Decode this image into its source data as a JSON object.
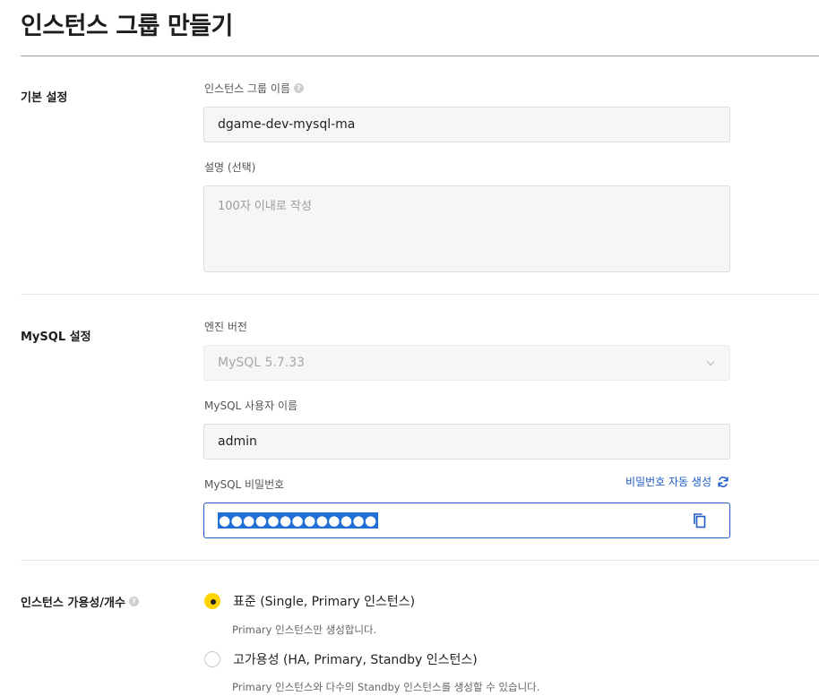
{
  "page": {
    "title": "인스턴스 그룹 만들기"
  },
  "basic": {
    "section_label": "기본 설정",
    "group_name_label": "인스턴스 그룹 이름",
    "group_name_value": "dgame-dev-mysql-ma",
    "description_label": "설명 (선택)",
    "description_placeholder": "100자 이내로 작성"
  },
  "mysql": {
    "section_label": "MySQL 설정",
    "engine_label": "엔진 버전",
    "engine_value": "MySQL 5.7.33",
    "username_label": "MySQL 사용자 이름",
    "username_value": "admin",
    "password_label": "MySQL 비밀번호",
    "password_autogen": "비밀번호 자동 생성",
    "password_mask": "●●●●●●●●●●●●●"
  },
  "availability": {
    "section_label": "인스턴스 가용성/개수",
    "options": [
      {
        "label": "표준 (Single, Primary 인스턴스)",
        "description": "Primary 인스턴스만 생성합니다.",
        "selected": true
      },
      {
        "label": "고가용성 (HA, Primary, Standby 인스턴스)",
        "description": "Primary 인스턴스와 다수의 Standby 인스턴스를 생성할 수 있습니다.",
        "selected": false
      }
    ]
  },
  "icons": {
    "help": "help-circle-icon",
    "chevron": "chevron-down-icon",
    "refresh": "refresh-icon",
    "copy": "copy-icon"
  },
  "colors": {
    "accent_blue": "#1f5cc8",
    "radio_selected": "#ffd400",
    "input_bg": "#f5f6f7"
  }
}
